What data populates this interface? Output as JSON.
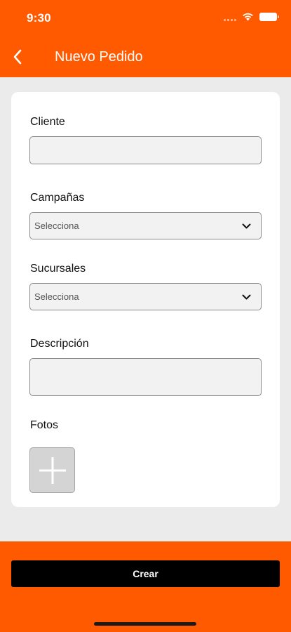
{
  "status_bar": {
    "time": "9:30"
  },
  "header": {
    "title": "Nuevo Pedido"
  },
  "form": {
    "cliente_label": "Cliente",
    "cliente_value": "",
    "campanas_label": "Campañas",
    "campanas_selected": "Selecciona",
    "sucursales_label": "Sucursales",
    "sucursales_selected": "Selecciona",
    "descripcion_label": "Descripción",
    "descripcion_value": "",
    "fotos_label": "Fotos"
  },
  "footer": {
    "create_label": "Crear"
  },
  "colors": {
    "accent": "#ff5a00",
    "button": "#000000",
    "background": "#ebebeb"
  },
  "icons": [
    "chevron-left-icon",
    "wifi-icon",
    "battery-icon",
    "chevron-down-icon",
    "plus-icon"
  ]
}
